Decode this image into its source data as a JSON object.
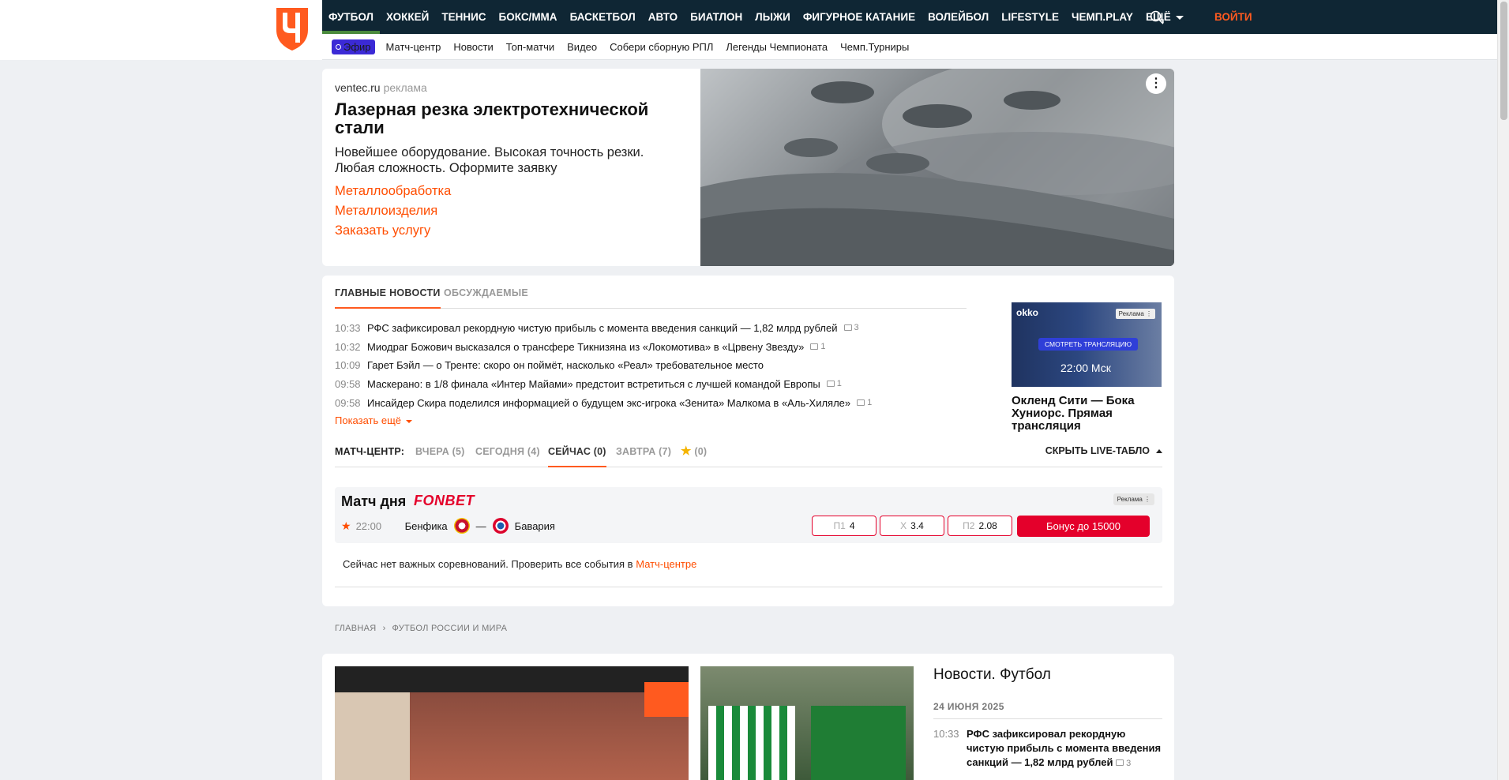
{
  "nav": {
    "items": [
      "ФУТБОЛ",
      "ХОККЕЙ",
      "ТЕННИС",
      "БОКС/ММА",
      "БАСКЕТБОЛ",
      "АВТО",
      "БИАТЛОН",
      "ЛЫЖИ",
      "ФИГУРНОЕ КАТАНИЕ",
      "ВОЛЕЙБОЛ",
      "LIFESTYLE",
      "ЧЕМП.PLAY",
      "ЕЩЁ"
    ],
    "login": "ВОЙТИ",
    "accent": "#ff5a1f",
    "bg": "#0f2634"
  },
  "subnav": {
    "efir": "Эфир",
    "items": [
      "Матч-центр",
      "Новости",
      "Топ-матчи",
      "Видео",
      "Собери сборную РПЛ",
      "Легенды Чемпионата",
      "Чемп.Турниры"
    ]
  },
  "ad": {
    "domain": "ventec.ru",
    "tag": "реклама",
    "title": "Лазерная резка электротехнической стали",
    "desc": "Новейшее оборудование. Высокая точность резки. Любая сложность. Оформите заявку",
    "links": [
      "Металлообработка",
      "Металлоизделия",
      "Заказать услугу"
    ]
  },
  "news": {
    "tabs": [
      "ГЛАВНЫЕ НОВОСТИ",
      "ОБСУЖДАЕМЫЕ"
    ],
    "items": [
      {
        "time": "10:33",
        "title": "РФС зафиксировал рекордную чистую прибыль с момента введения санкций — 1,82 млрд рублей",
        "comments": "3"
      },
      {
        "time": "10:32",
        "title": "Миодраг Божович высказался о трансфере Тикнизяна из «Локомотива» в «Црвену Звезду»",
        "comments": "1"
      },
      {
        "time": "10:09",
        "title": "Гарет Бэйл — о Тренте: скоро он поймёт, насколько «Реал» требовательное место",
        "comments": ""
      },
      {
        "time": "09:58",
        "title": "Маскерано: в 1/8 финала «Интер Майами» предстоит встретиться с лучшей командой Европы",
        "comments": "1"
      },
      {
        "time": "09:58",
        "title": "Инсайдер Скира поделился информацией о будущем экс-игрока «Зенита» Малкома в «Аль-Хиляле»",
        "comments": "1"
      }
    ],
    "show_more": "Показать ещё"
  },
  "promo": {
    "brand": "okko",
    "tag": "Реклама",
    "watch": "СМОТРЕТЬ ТРАНСЛЯЦИЮ",
    "time": "22:00 Мск",
    "title": "Окленд Сити — Бока Хуниорс. Прямая трансляция"
  },
  "match_center": {
    "label": "МАТЧ-ЦЕНТР:",
    "tabs": [
      "ВЧЕРА (5)",
      "СЕГОДНЯ (4)",
      "СЕЙЧАС (0)",
      "ЗАВТРА (7)",
      "(0)"
    ],
    "hide": "СКРЫТЬ LIVE-ТАБЛО"
  },
  "match_of_day": {
    "title": "Матч дня",
    "sponsor": "FONBET",
    "tag": "Реклама",
    "time": "22:00",
    "home": "Бенфика",
    "dash": "—",
    "away": "Бавария",
    "odds": [
      {
        "k": "П1",
        "v": "4"
      },
      {
        "k": "Х",
        "v": "3.4"
      },
      {
        "k": "П2",
        "v": "2.08"
      }
    ],
    "bonus": "Бонус до 15000"
  },
  "no_events": {
    "text": "Сейчас нет важных соревнований. Проверить все события в ",
    "link": "Матч-центре"
  },
  "breadcrumb": [
    "ГЛАВНАЯ",
    "ФУТБОЛ РОССИИ И МИРА"
  ],
  "feed": {
    "title": "Новости. Футбол",
    "date": "24 ИЮНЯ 2025",
    "items": [
      {
        "time": "10:33",
        "title": "РФС зафиксировал рекордную чистую прибыль с момента введения санкций — 1,82 млрд рублей",
        "comments": "3"
      }
    ]
  }
}
